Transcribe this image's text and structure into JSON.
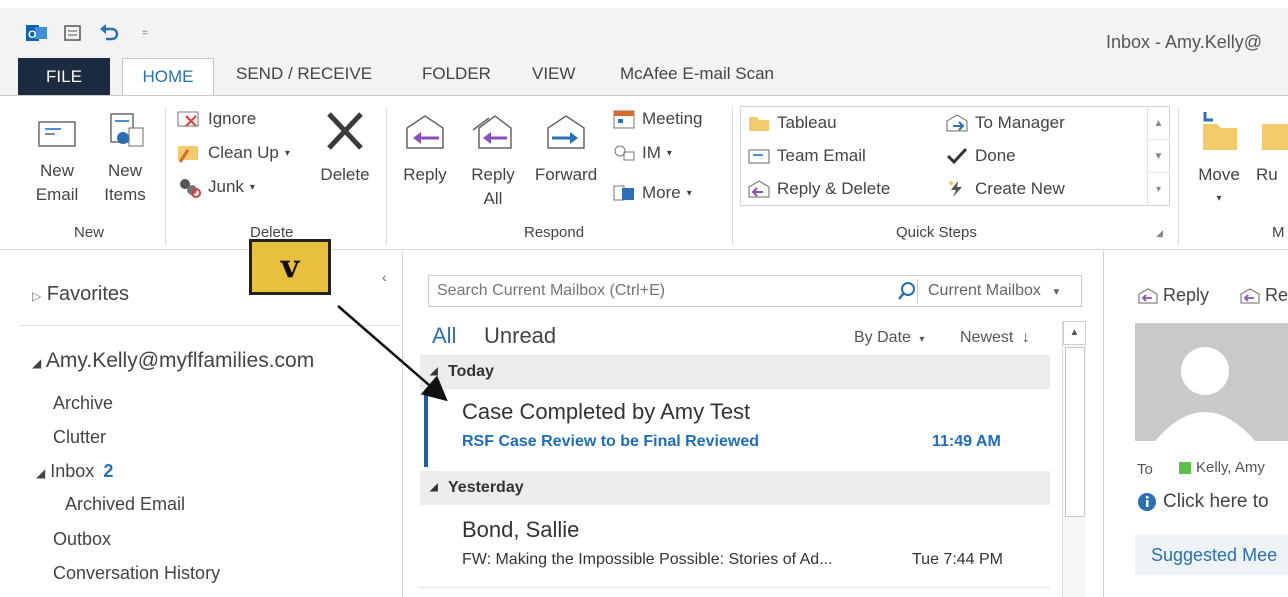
{
  "window": {
    "title": "Inbox - Amy.Kelly@"
  },
  "quick_access": {
    "icons": [
      "outlook-icon",
      "send-receive-icon",
      "undo-icon",
      "customize-icon"
    ]
  },
  "tabs": [
    {
      "label": "FILE"
    },
    {
      "label": "HOME"
    },
    {
      "label": "SEND / RECEIVE"
    },
    {
      "label": "FOLDER"
    },
    {
      "label": "VIEW"
    },
    {
      "label": "McAfee E-mail Scan"
    }
  ],
  "ribbon": {
    "new": {
      "new_email": "New\nEmail",
      "new_items": "New\nItems",
      "group": "New"
    },
    "delete": {
      "ignore": "Ignore",
      "clean_up": "Clean Up",
      "junk": "Junk",
      "delete": "Delete",
      "group": "Delete"
    },
    "respond": {
      "reply": "Reply",
      "reply_all": "Reply\nAll",
      "forward": "Forward",
      "meeting": "Meeting",
      "im": "IM",
      "more": "More",
      "group": "Respond"
    },
    "quick_steps": {
      "items": [
        "Tableau",
        "To Manager",
        "Team Email",
        "Done",
        "Reply & Delete",
        "Create New"
      ],
      "group": "Quick Steps"
    },
    "move": {
      "move": "Move",
      "rules": "Ru",
      "group": "M"
    }
  },
  "nav": {
    "favorites": "Favorites",
    "account": "Amy.Kelly@myflfamilies.com",
    "folders": [
      {
        "label": "Archive",
        "count": ""
      },
      {
        "label": "Clutter",
        "count": ""
      },
      {
        "label": "Inbox",
        "count": "2"
      },
      {
        "label": "Archived Email",
        "count": ""
      },
      {
        "label": "Outbox",
        "count": ""
      },
      {
        "label": "Conversation History",
        "count": ""
      }
    ]
  },
  "list": {
    "search_placeholder": "Search Current Mailbox (Ctrl+E)",
    "scope": "Current Mailbox",
    "filters": {
      "all": "All",
      "unread": "Unread"
    },
    "sort": {
      "by": "By Date",
      "order": "Newest"
    },
    "groups": [
      {
        "header": "Today",
        "messages": [
          {
            "from": "Case Completed by Amy Test",
            "subject": "RSF Case Review to be Final Reviewed",
            "time": "11:49 AM",
            "unread": true
          }
        ]
      },
      {
        "header": "Yesterday",
        "messages": [
          {
            "from": "Bond, Sallie",
            "subject": "FW:  Making the Impossible Possible:  Stories of Ad...",
            "time": "Tue 7:44 PM",
            "unread": false
          }
        ]
      }
    ]
  },
  "reading": {
    "reply": "Reply",
    "reply_all": "Re",
    "to_label": "To",
    "to_value": "Kelly, Amy",
    "info": "Click here to",
    "suggested": "Suggested Mee"
  },
  "annotation": {
    "label": "v"
  },
  "colors": {
    "accent": "#2b6fb6",
    "file_tab": "#1c2b3f",
    "callout": "#e8c03b",
    "unread_bar": "#1e5fa8"
  }
}
